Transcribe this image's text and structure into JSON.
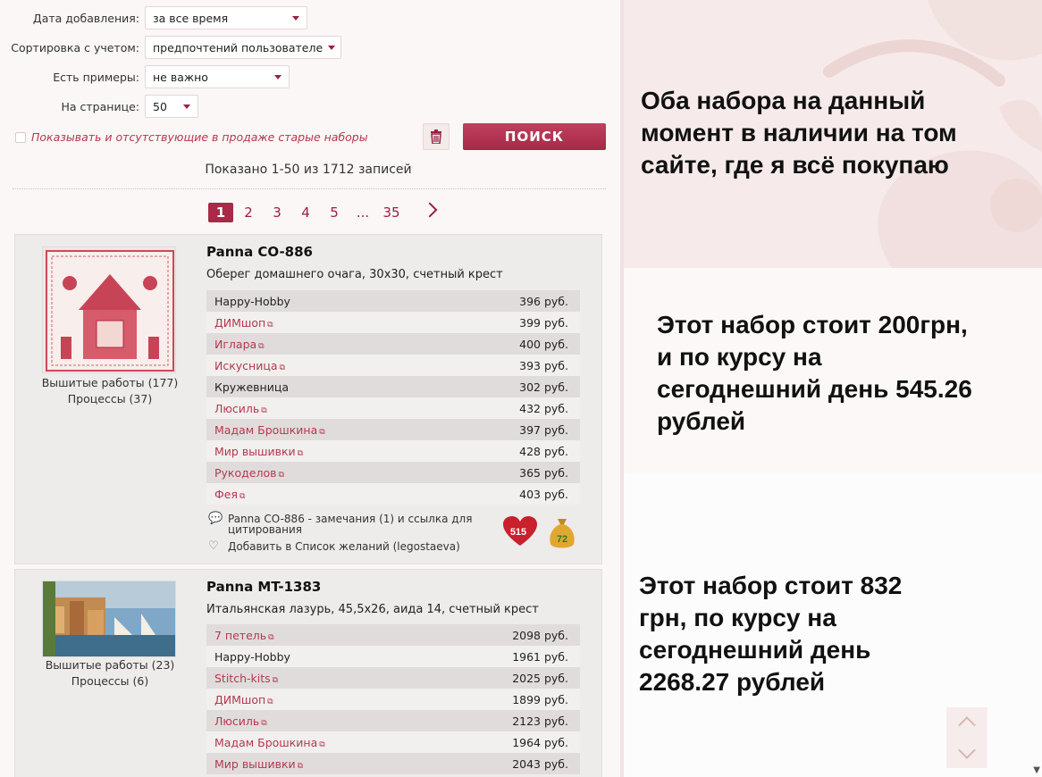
{
  "filters": {
    "date": {
      "label": "Дата добавления:",
      "value": "за все время"
    },
    "sort": {
      "label": "Сортировка с учетом:",
      "value": "предпочтений пользователей"
    },
    "examples": {
      "label": "Есть примеры:",
      "value": "не важно"
    },
    "per_page": {
      "label": "На странице:",
      "value": "50"
    },
    "show_old_label": "Показывать и отсутствующие в продаже старые наборы",
    "search_label": "ПОИСК"
  },
  "results_info": "Показано 1-50 из 1712 записей",
  "pagination": {
    "pages": [
      "1",
      "2",
      "3",
      "4",
      "5",
      "...",
      "35"
    ],
    "active": "1"
  },
  "kits": [
    {
      "title": "Panna CO-886",
      "description": "Оберег домашнего очага, 30х30, счетный крест",
      "works": "Вышитые работы (177)",
      "processes": "Процессы (37)",
      "offers": [
        {
          "shop": "Happy-Hobby",
          "price": "396 руб.",
          "link": false
        },
        {
          "shop": "ДИМшоп",
          "price": "399 руб.",
          "link": true
        },
        {
          "shop": "Иглара",
          "price": "400 руб.",
          "link": true
        },
        {
          "shop": "Искусница",
          "price": "393 руб.",
          "link": true
        },
        {
          "shop": "Кружевница",
          "price": "302 руб.",
          "link": false
        },
        {
          "shop": "Люсиль",
          "price": "432 руб.",
          "link": true
        },
        {
          "shop": "Мадам Брошкина",
          "price": "397 руб.",
          "link": true
        },
        {
          "shop": "Мир вышивки",
          "price": "428 руб.",
          "link": true
        },
        {
          "shop": "Рукоделов",
          "price": "365 руб.",
          "link": true
        },
        {
          "shop": "Фея",
          "price": "403 руб.",
          "link": true
        }
      ],
      "comments": "Panna CO-886 - замечания (1) и ссылка для цитирования",
      "wishlist": "Добавить в Список желаний (legostaeva)",
      "likes": "515",
      "bag_count": "72"
    },
    {
      "title": "Panna MT-1383",
      "description": "Итальянская лазурь, 45,5х26, аида 14, счетный крест",
      "works": "Вышитые работы (23)",
      "processes": "Процессы (6)",
      "offers": [
        {
          "shop": "7 петель",
          "price": "2098 руб.",
          "link": true
        },
        {
          "shop": "Happy-Hobby",
          "price": "1961 руб.",
          "link": false
        },
        {
          "shop": "Stitch-kits",
          "price": "2025 руб.",
          "link": true
        },
        {
          "shop": "ДИМшоп",
          "price": "1899 руб.",
          "link": true
        },
        {
          "shop": "Люсиль",
          "price": "2123 руб.",
          "link": true
        },
        {
          "shop": "Мадам Брошкина",
          "price": "1964 руб.",
          "link": true
        },
        {
          "shop": "Мир вышивки",
          "price": "2043 руб.",
          "link": true
        }
      ]
    }
  ],
  "overlays": {
    "text1": "Оба набора на данный момент в наличии на том сайте, где я всё покупаю",
    "text2": "Этот набор стоит 200грн, и по курсу на сегоднешний день 545.26 рублей",
    "text3": "Этот набор стоит 832 грн, по курсу на сегоднешний день 2268.27 рублей"
  },
  "colors": {
    "accent": "#a82a48",
    "link": "#b03a4e"
  }
}
